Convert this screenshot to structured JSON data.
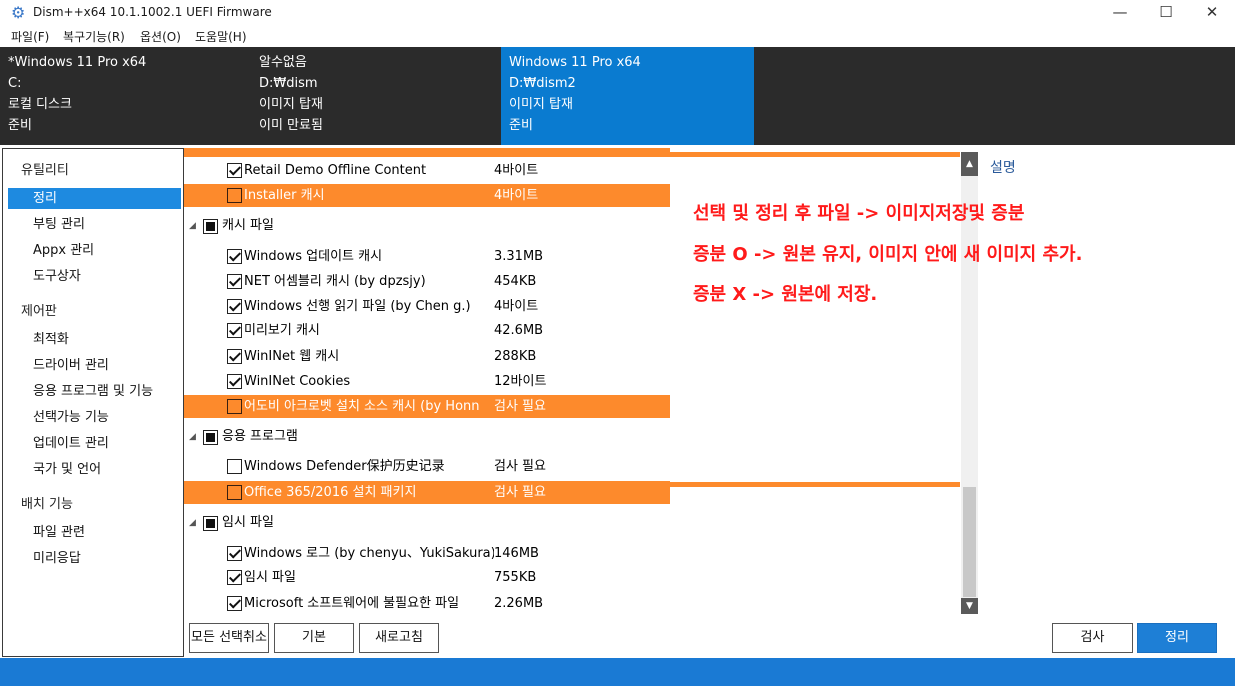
{
  "window": {
    "title": "Dism++x64 10.1.1002.1 UEFI Firmware",
    "minimize": "—",
    "maximize": "☐",
    "close": "✕"
  },
  "menu": [
    "파일(F)",
    "복구기능(R)",
    "옵션(O)",
    "도움말(H)"
  ],
  "images": [
    {
      "name": "*Windows 11 Pro x64",
      "path": "C:",
      "type": "로컬 디스크",
      "status": "준비",
      "selected": false
    },
    {
      "name": "알수없음",
      "path": "D:₩dism",
      "type": "이미지 탑재",
      "status": "이미 만료됨",
      "selected": false
    },
    {
      "name": "Windows 11 Pro x64",
      "path": "D:₩dism2",
      "type": "이미지 탑재",
      "status": "준비",
      "selected": true
    }
  ],
  "sidebar": {
    "groups": [
      {
        "label": "유틸리티",
        "items": [
          "정리",
          "부팅 관리",
          "Appx 관리",
          "도구상자"
        ]
      },
      {
        "label": "제어판",
        "items": [
          "최적화",
          "드라이버 관리",
          "응용 프로그램 및 기능",
          "선택가능 기능",
          "업데이트 관리",
          "국가 및 언어"
        ]
      },
      {
        "label": "배치 기능",
        "items": [
          "파일 관련",
          "미리응답"
        ]
      }
    ],
    "active": "정리"
  },
  "tree": {
    "rows_top": [
      {
        "name": "Retail Demo Offline Content",
        "size": "4바이트",
        "checked": true,
        "highlight": false
      },
      {
        "name": "Installer 캐시",
        "size": "4바이트",
        "checked": false,
        "highlight": true
      }
    ],
    "categories": [
      {
        "label": "캐시 파일",
        "items": [
          {
            "name": "Windows 업데이트 캐시",
            "size": "3.31MB",
            "checked": true,
            "highlight": false
          },
          {
            "name": "NET 어셈블리 캐시 (by dpzsjy)",
            "size": "454KB",
            "checked": true,
            "highlight": false
          },
          {
            "name": "Windows 선행 읽기 파일 (by Chen g.)",
            "size": "4바이트",
            "checked": true,
            "highlight": false
          },
          {
            "name": "미리보기 캐시",
            "size": "42.6MB",
            "checked": true,
            "highlight": false
          },
          {
            "name": "WinINet 웹 캐시",
            "size": "288KB",
            "checked": true,
            "highlight": false
          },
          {
            "name": "WinINet Cookies",
            "size": "12바이트",
            "checked": true,
            "highlight": false
          },
          {
            "name": "어도비 아크로벳 설치 소스 캐시 (by Honn",
            "size": "검사 필요",
            "checked": false,
            "highlight": true
          }
        ]
      },
      {
        "label": "응용 프로그램",
        "items": [
          {
            "name": "Windows Defender保护历史记录",
            "size": "검사 필요",
            "checked": false,
            "highlight": false
          },
          {
            "name": "Office 365/2016 설치 패키지",
            "size": "검사 필요",
            "checked": false,
            "highlight": true
          }
        ]
      },
      {
        "label": "임시 파일",
        "items": [
          {
            "name": "Windows 로그 (by chenyu、YukiSakura)",
            "size": "146MB",
            "checked": true,
            "highlight": false
          },
          {
            "name": "임시 파일",
            "size": "755KB",
            "checked": true,
            "highlight": false
          },
          {
            "name": "Microsoft 소프트웨어에 불필요한 파일",
            "size": "2.26MB",
            "checked": true,
            "highlight": false
          }
        ]
      }
    ]
  },
  "description_label": "설명",
  "notes": [
    "선택 및 정리 후 파일 -> 이미지저장및 증분",
    "증분 O -> 원본 유지, 이미지 안에 새 이미지 추가.",
    "증분 X -> 원본에 저장."
  ],
  "buttons": {
    "deselect_all": "모든 선택취소",
    "default": "기본",
    "refresh": "새로고침",
    "scan": "검사",
    "clean": "정리"
  },
  "colors": {
    "highlight": "#fd8a2c",
    "accent": "#1e7fd6",
    "image_bar": "#2b2b2b",
    "note_text": "#ff1a1a"
  }
}
